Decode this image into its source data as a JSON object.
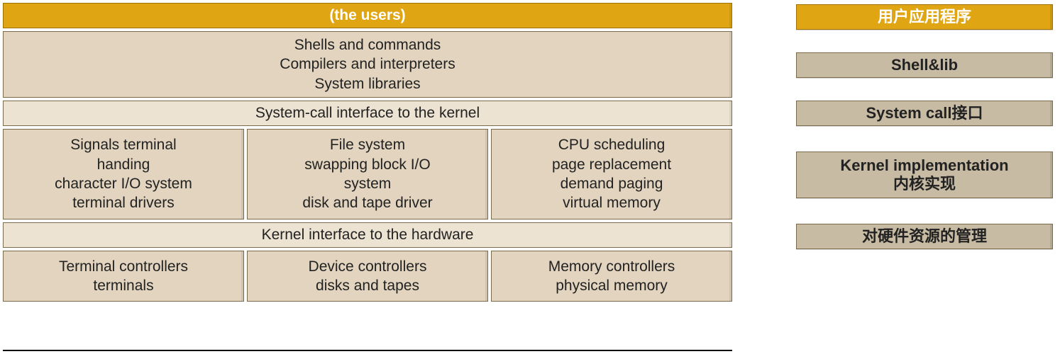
{
  "layers": {
    "users": "(the users)",
    "shell": {
      "l1": "Shells and commands",
      "l2": "Compilers and interpreters",
      "l3": "System libraries"
    },
    "syscall": "System-call interface to the kernel",
    "kernel": {
      "c1": {
        "l1": "Signals terminal",
        "l2": "handing",
        "l3": "character I/O system",
        "l4": "terminal drivers"
      },
      "c2": {
        "l1": "File system",
        "l2": "swapping block I/O",
        "l3": "system",
        "l4": "disk and tape driver"
      },
      "c3": {
        "l1": "CPU scheduling",
        "l2": "page replacement",
        "l3": "demand paging",
        "l4": "virtual memory"
      }
    },
    "hwiface": "Kernel interface to the hardware",
    "hardware": {
      "c1": {
        "l1": "Terminal controllers",
        "l2": "terminals"
      },
      "c2": {
        "l1": "Device controllers",
        "l2": "disks and tapes"
      },
      "c3": {
        "l1": "Memory controllers",
        "l2": "physical memory"
      }
    }
  },
  "labels": {
    "r1": "用户应用程序",
    "r2": "Shell&lib",
    "r3": "System call接口",
    "r4a": "Kernel implementation",
    "r4b": "内核实现",
    "r5": "对硬件资源的管理"
  }
}
